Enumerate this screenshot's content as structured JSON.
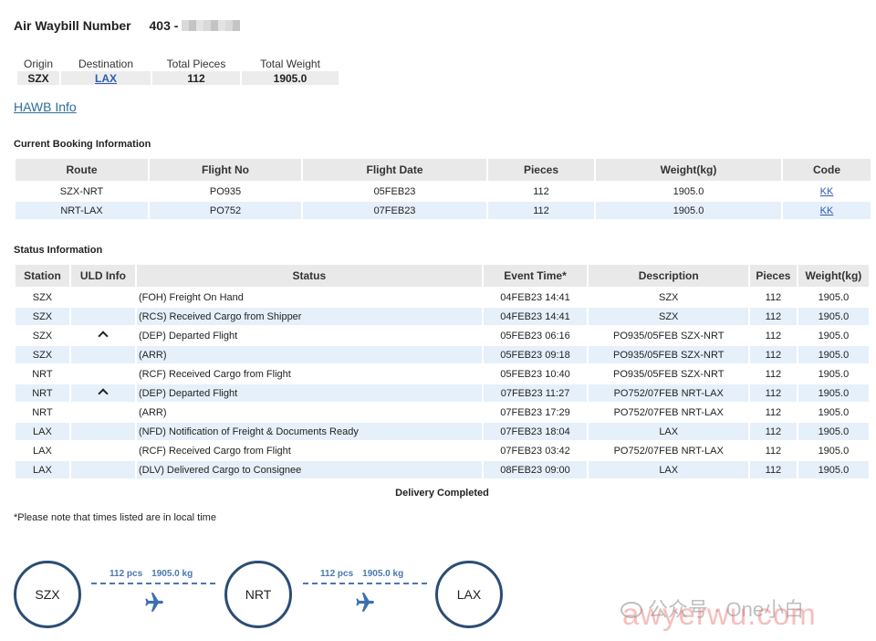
{
  "header": {
    "label": "Air Waybill Number",
    "prefix": "403 -"
  },
  "summary": {
    "headers": [
      "Origin",
      "Destination",
      "Total Pieces",
      "Total Weight"
    ],
    "origin": "SZX",
    "destination": "LAX",
    "pieces": "112",
    "weight": "1905.0"
  },
  "hawb_link": "HAWB Info",
  "booking": {
    "title": "Current Booking Information",
    "headers": [
      "Route",
      "Flight No",
      "Flight Date",
      "Pieces",
      "Weight(kg)",
      "Code"
    ],
    "rows": [
      {
        "route": "SZX-NRT",
        "flight": "PO935",
        "date": "05FEB23",
        "pieces": "112",
        "weight": "1905.0",
        "code": "KK"
      },
      {
        "route": "NRT-LAX",
        "flight": "PO752",
        "date": "07FEB23",
        "pieces": "112",
        "weight": "1905.0",
        "code": "KK"
      }
    ]
  },
  "status": {
    "title": "Status Information",
    "headers": [
      "Station",
      "ULD Info",
      "Status",
      "Event Time*",
      "Description",
      "Pieces",
      "Weight(kg)"
    ],
    "rows": [
      {
        "station": "SZX",
        "uld": false,
        "status": "(FOH) Freight On Hand",
        "time": "04FEB23 14:41",
        "desc": "SZX",
        "pieces": "112",
        "weight": "1905.0"
      },
      {
        "station": "SZX",
        "uld": false,
        "status": "(RCS) Received Cargo from Shipper",
        "time": "04FEB23 14:41",
        "desc": "SZX",
        "pieces": "112",
        "weight": "1905.0"
      },
      {
        "station": "SZX",
        "uld": true,
        "status": "(DEP) Departed Flight",
        "time": "05FEB23 06:16",
        "desc": "PO935/05FEB SZX-NRT",
        "pieces": "112",
        "weight": "1905.0"
      },
      {
        "station": "SZX",
        "uld": false,
        "status": "(ARR)",
        "time": "05FEB23 09:18",
        "desc": "PO935/05FEB SZX-NRT",
        "pieces": "112",
        "weight": "1905.0"
      },
      {
        "station": "NRT",
        "uld": false,
        "status": "(RCF) Received Cargo from Flight",
        "time": "05FEB23 10:40",
        "desc": "PO935/05FEB SZX-NRT",
        "pieces": "112",
        "weight": "1905.0"
      },
      {
        "station": "NRT",
        "uld": true,
        "status": "(DEP) Departed Flight",
        "time": "07FEB23 11:27",
        "desc": "PO752/07FEB NRT-LAX",
        "pieces": "112",
        "weight": "1905.0"
      },
      {
        "station": "NRT",
        "uld": false,
        "status": "(ARR)",
        "time": "07FEB23 17:29",
        "desc": "PO752/07FEB NRT-LAX",
        "pieces": "112",
        "weight": "1905.0"
      },
      {
        "station": "LAX",
        "uld": false,
        "status": "(NFD) Notification of Freight & Documents Ready",
        "time": "07FEB23 18:04",
        "desc": "LAX",
        "pieces": "112",
        "weight": "1905.0"
      },
      {
        "station": "LAX",
        "uld": false,
        "status": "(RCF) Received Cargo from Flight",
        "time": "07FEB23 03:42",
        "desc": "PO752/07FEB NRT-LAX",
        "pieces": "112",
        "weight": "1905.0"
      },
      {
        "station": "LAX",
        "uld": false,
        "status": "(DLV) Delivered Cargo to Consignee",
        "time": "08FEB23 09:00",
        "desc": "LAX",
        "pieces": "112",
        "weight": "1905.0"
      }
    ],
    "completed": "Delivery Completed"
  },
  "note": "*Please note that times listed are in local time",
  "route_map": {
    "nodes": [
      "SZX",
      "NRT",
      "LAX"
    ],
    "segments": [
      {
        "pcs": "112 pcs",
        "kg": "1905.0 kg"
      },
      {
        "pcs": "112 pcs",
        "kg": "1905.0 kg"
      }
    ]
  },
  "watermarks": {
    "account": "公众号 · One小白",
    "site": "awyerwu.com"
  },
  "colors": {
    "link": "#2a5db0",
    "row_alt": "#e6f0fa",
    "header_bg": "#e9e9e9",
    "node_border": "#2b4d75",
    "route_accent": "#4a78b0"
  }
}
